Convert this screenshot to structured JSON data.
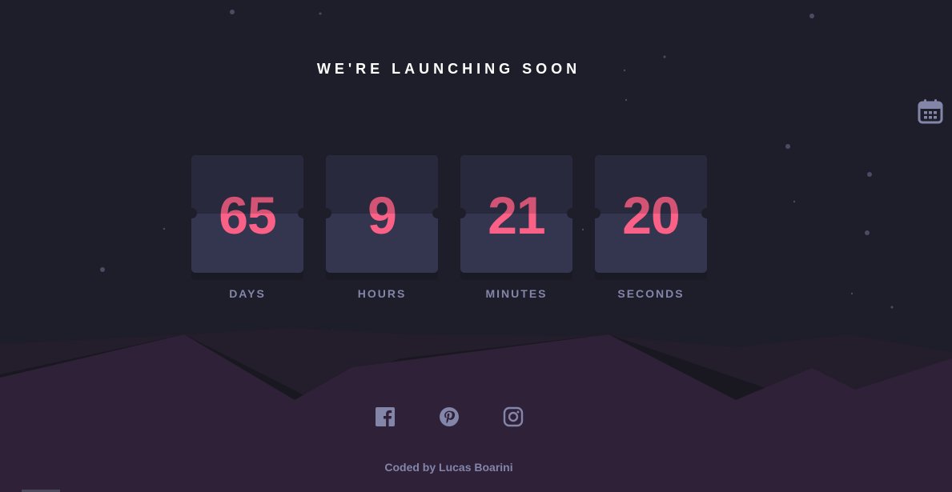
{
  "page": {
    "title": "WE'RE LAUNCHING SOON",
    "credit_prefix": "Coded by",
    "credit_name": "Lucas Boarini"
  },
  "countdown": [
    {
      "value": "65",
      "label": "DAYS"
    },
    {
      "value": "9",
      "label": "HOURS"
    },
    {
      "value": "21",
      "label": "MINUTES"
    },
    {
      "value": "20",
      "label": "SECONDS"
    }
  ],
  "icons": {
    "calendar": "calendar-icon",
    "socials": [
      "facebook-icon",
      "pinterest-icon",
      "instagram-icon"
    ]
  },
  "colors": {
    "background": "#1e1e2a",
    "accent": "#fb6087",
    "muted": "#8385a9",
    "card": "#343650",
    "hills": "#2e2138"
  }
}
